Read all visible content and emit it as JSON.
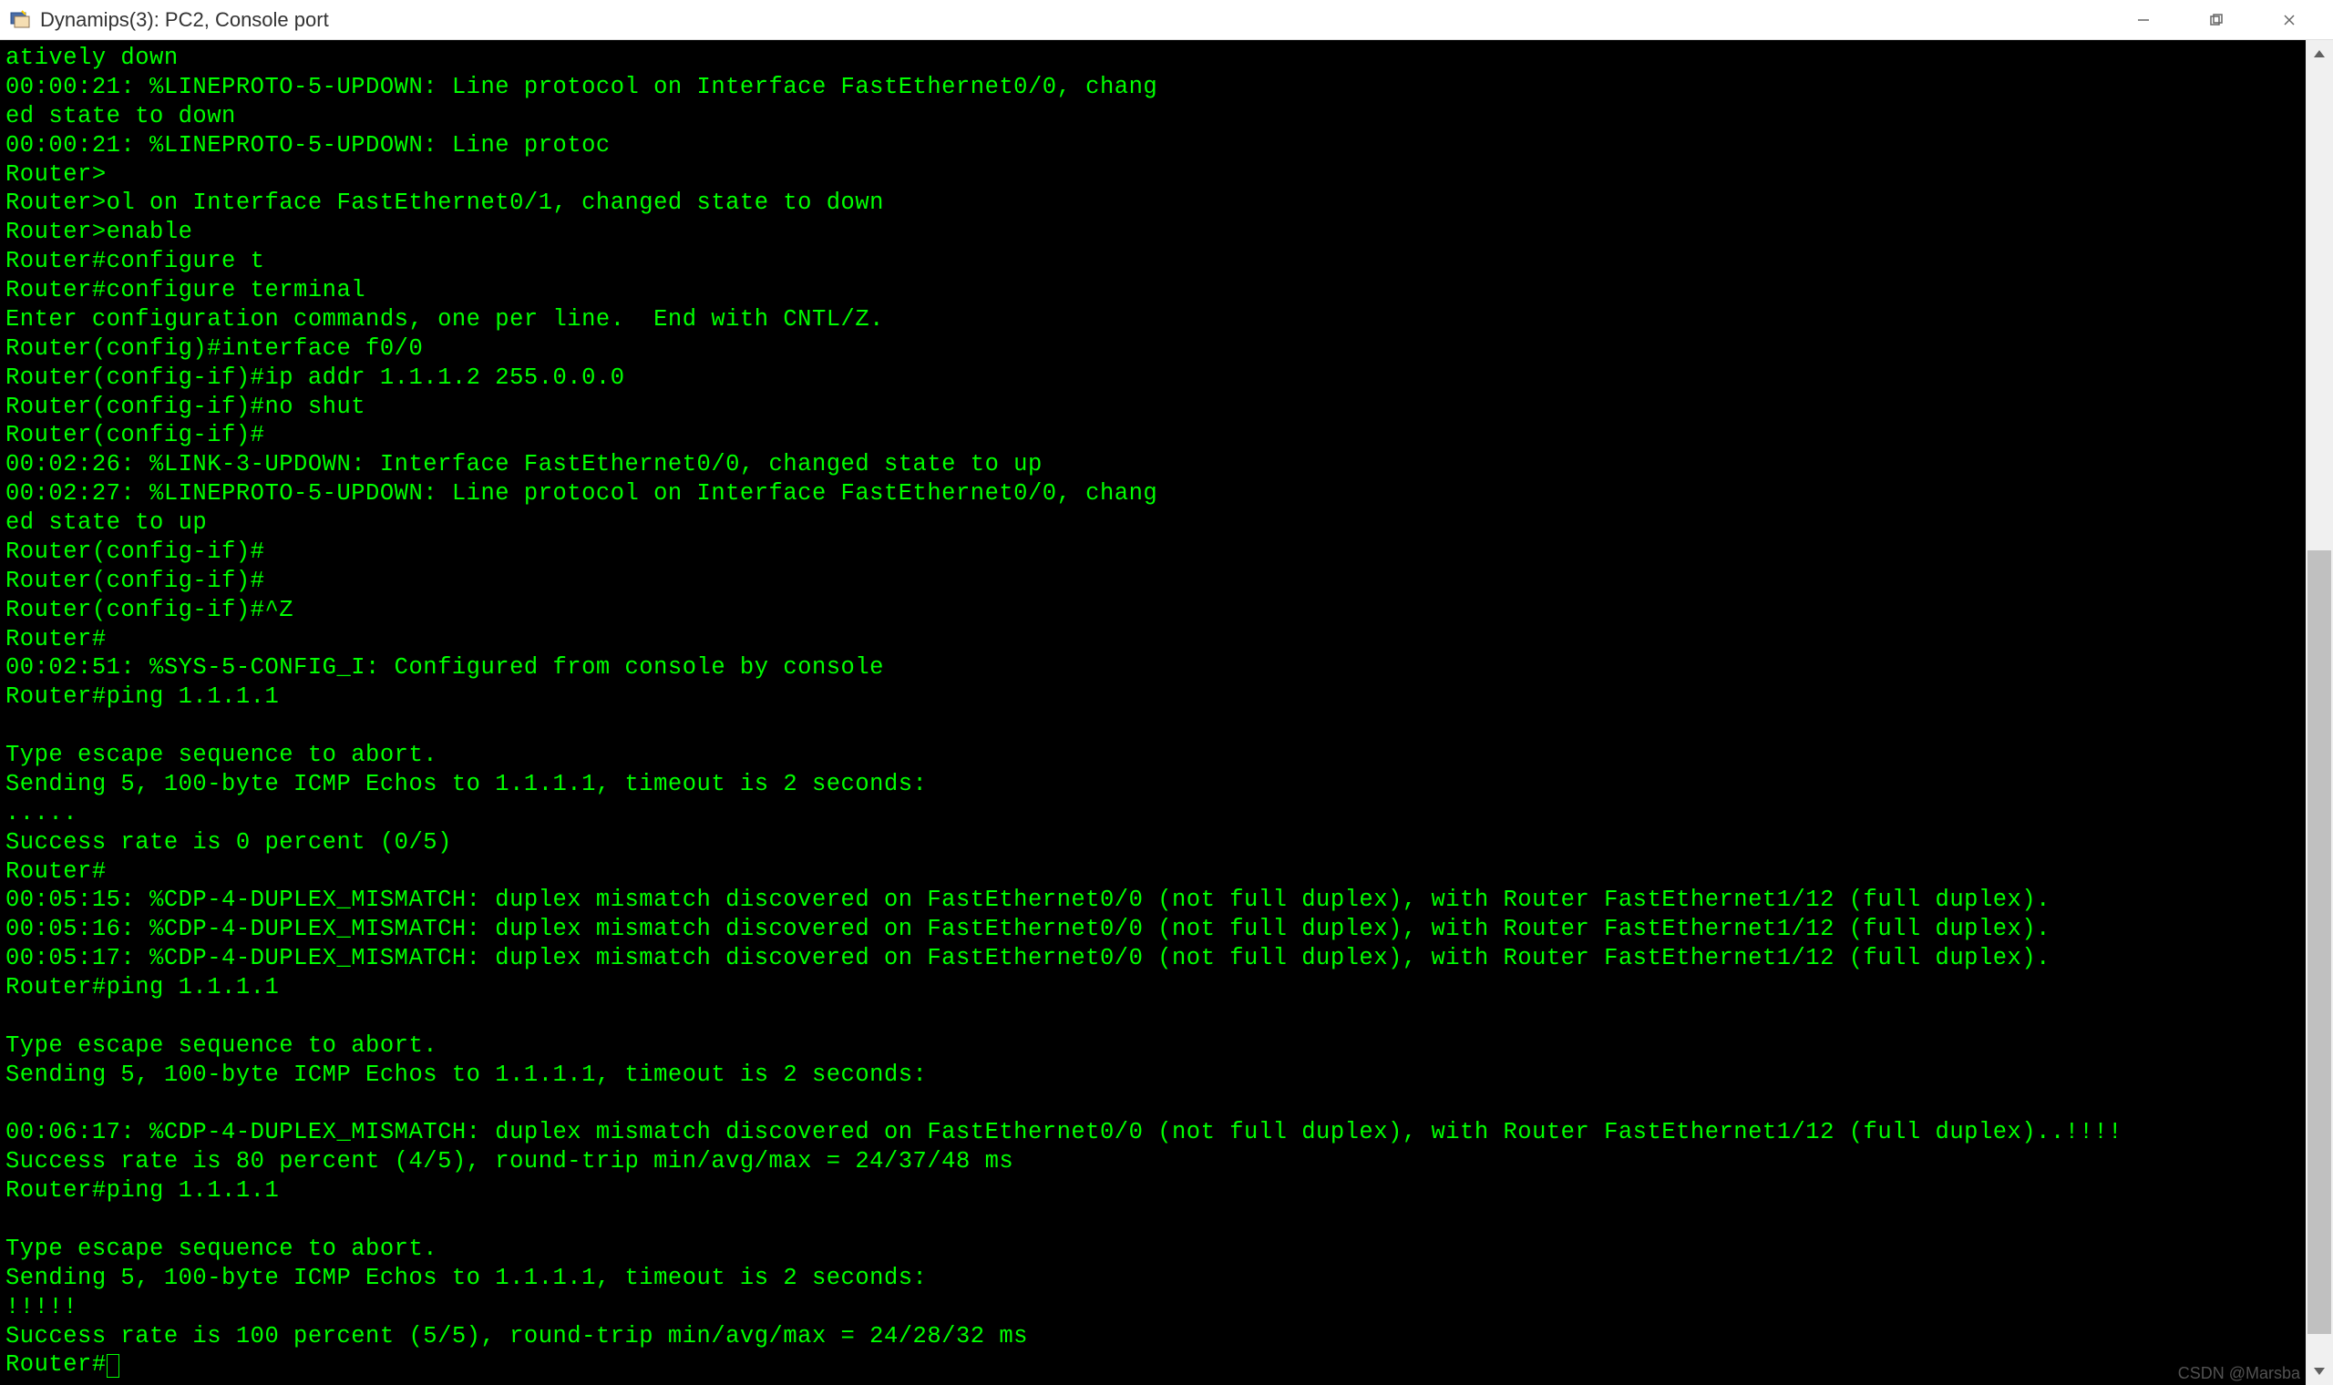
{
  "window": {
    "title": "Dynamips(3): PC2, Console port"
  },
  "terminal": {
    "lines": [
      "atively down",
      "00:00:21: %LINEPROTO-5-UPDOWN: Line protocol on Interface FastEthernet0/0, chang",
      "ed state to down",
      "00:00:21: %LINEPROTO-5-UPDOWN: Line protoc",
      "Router>",
      "Router>ol on Interface FastEthernet0/1, changed state to down",
      "Router>enable",
      "Router#configure t",
      "Router#configure terminal",
      "Enter configuration commands, one per line.  End with CNTL/Z.",
      "Router(config)#interface f0/0",
      "Router(config-if)#ip addr 1.1.1.2 255.0.0.0",
      "Router(config-if)#no shut",
      "Router(config-if)#",
      "00:02:26: %LINK-3-UPDOWN: Interface FastEthernet0/0, changed state to up",
      "00:02:27: %LINEPROTO-5-UPDOWN: Line protocol on Interface FastEthernet0/0, chang",
      "ed state to up",
      "Router(config-if)#",
      "Router(config-if)#",
      "Router(config-if)#^Z",
      "Router#",
      "00:02:51: %SYS-5-CONFIG_I: Configured from console by console",
      "Router#ping 1.1.1.1",
      "",
      "Type escape sequence to abort.",
      "Sending 5, 100-byte ICMP Echos to 1.1.1.1, timeout is 2 seconds:",
      ".....",
      "Success rate is 0 percent (0/5)",
      "Router#",
      "00:05:15: %CDP-4-DUPLEX_MISMATCH: duplex mismatch discovered on FastEthernet0/0 (not full duplex), with Router FastEthernet1/12 (full duplex).",
      "00:05:16: %CDP-4-DUPLEX_MISMATCH: duplex mismatch discovered on FastEthernet0/0 (not full duplex), with Router FastEthernet1/12 (full duplex).",
      "00:05:17: %CDP-4-DUPLEX_MISMATCH: duplex mismatch discovered on FastEthernet0/0 (not full duplex), with Router FastEthernet1/12 (full duplex).",
      "Router#ping 1.1.1.1",
      "",
      "Type escape sequence to abort.",
      "Sending 5, 100-byte ICMP Echos to 1.1.1.1, timeout is 2 seconds:",
      "",
      "00:06:17: %CDP-4-DUPLEX_MISMATCH: duplex mismatch discovered on FastEthernet0/0 (not full duplex), with Router FastEthernet1/12 (full duplex)..!!!!",
      "Success rate is 80 percent (4/5), round-trip min/avg/max = 24/37/48 ms",
      "Router#ping 1.1.1.1",
      "",
      "Type escape sequence to abort.",
      "Sending 5, 100-byte ICMP Echos to 1.1.1.1, timeout is 2 seconds:",
      "!!!!!",
      "Success rate is 100 percent (5/5), round-trip min/avg/max = 24/28/32 ms"
    ],
    "prompt": "Router#"
  },
  "watermark": "CSDN @Marsba"
}
